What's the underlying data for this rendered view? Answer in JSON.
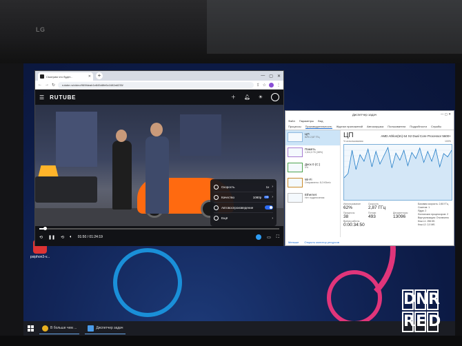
{
  "monitor": {
    "brand": "LG"
  },
  "browser": {
    "tab_title": "Смотрим что будет...",
    "url": "rutube.ru/video/969fdeab1e845d8fe5c1682a6235/",
    "rutube": {
      "logo": "RUTUBE",
      "settings": {
        "speed_label": "Скорость",
        "speed_value": "1x",
        "quality_label": "Качество",
        "quality_value": "1080p",
        "quality_badge": "HD",
        "autoplay_label": "Автовоспроизведение",
        "more_label": "Ещё"
      },
      "player": {
        "time": "01:50 / 01:24:19",
        "progress": 0.022
      }
    }
  },
  "taskmgr": {
    "title": "Диспетчер задач",
    "menu": [
      "Файл",
      "Параметры",
      "Вид"
    ],
    "tabs": [
      "Процессы",
      "Производительность",
      "Журнал приложений",
      "Автозагрузка",
      "Пользователи",
      "Подробности",
      "Службы"
    ],
    "active_tab": 1,
    "side_items": [
      {
        "name": "ЦП",
        "sub": "62% 2,87 ГГц"
      },
      {
        "name": "Память",
        "sub": "1,5/4,0 ГБ (38%)"
      },
      {
        "name": "Диск 0 (C:)",
        "sub": "0%"
      },
      {
        "name": "Wi-Fi",
        "sub": "Отправлено: 8,0 Кбит/с"
      },
      {
        "name": "Ethernet",
        "sub": "Нет подключения"
      }
    ],
    "cpu": {
      "heading": "ЦП",
      "name": "AMD Athlon(tm) 64 X2 Dual Core Processor 5600+",
      "graph_label": "% использования",
      "graph_max": "100%",
      "utilization_label": "Использование",
      "utilization": "62%",
      "speed_label": "Скорость",
      "speed": "2,87 ГГц",
      "processes_label": "Процессы",
      "processes": "38",
      "threads_label": "Потоки",
      "threads": "493",
      "handles_label": "Дескрипторы",
      "handles": "13096",
      "uptime_label": "Время работы",
      "uptime": "0:00:34:50",
      "side_info": [
        "Базовая скорость: 2,80 ГГц",
        "Сокетов: 1",
        "Ядра: 2",
        "Логических процессоров: 2",
        "Виртуализация: Отключено",
        "Кэш L1: 256 КБ",
        "Кэш L2: 2,0 МБ"
      ],
      "graph_values": [
        40,
        48,
        90,
        55,
        82,
        70,
        92,
        60,
        88,
        65,
        80,
        95,
        58,
        85,
        72,
        90,
        62,
        86,
        75,
        94,
        68,
        88,
        70,
        92,
        60,
        84,
        78,
        90
      ]
    },
    "footer": [
      "Меньше",
      "Открыть монитор ресурсов"
    ]
  },
  "desktop_icon": {
    "label": "psiphon3-v..."
  },
  "taskbar": {
    "apps": [
      {
        "label": "В больше чем ...",
        "color": "#e8b020"
      },
      {
        "label": "Диспетчер задач",
        "color": "#4a9be8"
      }
    ]
  },
  "watermark": {
    "line1": "DNR",
    "line2": "RED"
  }
}
